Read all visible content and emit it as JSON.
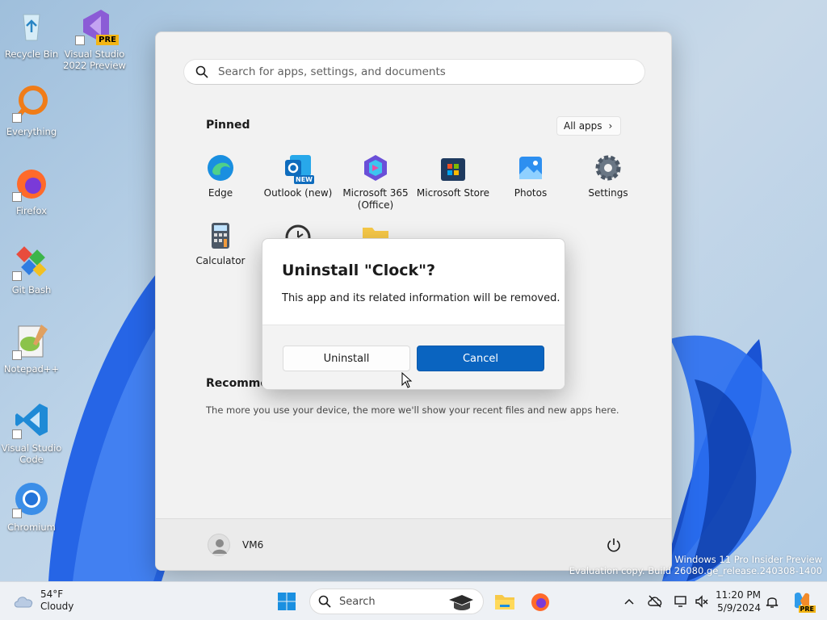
{
  "desktop": {
    "icons": [
      {
        "label": "Recycle Bin"
      },
      {
        "label": "Visual Studio 2022 Preview",
        "badge": "PRE"
      },
      {
        "label": "Everything"
      },
      {
        "label": "Firefox"
      },
      {
        "label": "Git Bash"
      },
      {
        "label": "Notepad++"
      },
      {
        "label": "Visual Studio Code"
      },
      {
        "label": "Chromium"
      }
    ],
    "watermark_line1": "Windows 11 Pro Insider Preview",
    "watermark_line2": "Evaluation copy. Build 26080.ge_release.240308-1400"
  },
  "start_menu": {
    "search_placeholder": "Search for apps, settings, and documents",
    "pinned_title": "Pinned",
    "all_apps_label": "All apps",
    "apps": [
      {
        "label": "Edge"
      },
      {
        "label": "Outlook (new)",
        "badge": "NEW"
      },
      {
        "label": "Microsoft 365 (Office)"
      },
      {
        "label": "Microsoft Store"
      },
      {
        "label": "Photos"
      },
      {
        "label": "Settings"
      },
      {
        "label": "Calculator"
      }
    ],
    "recommended_title": "Recommen",
    "recommended_text": "The more you use your device, the more we'll show your recent files and new apps here.",
    "user_name": "VM6"
  },
  "dialog": {
    "title": "Uninstall \"Clock\"?",
    "message": "This app and its related information will be removed.",
    "uninstall_label": "Uninstall",
    "cancel_label": "Cancel"
  },
  "taskbar": {
    "weather_temp": "54°F",
    "weather_desc": "Cloudy",
    "search_placeholder": "Search",
    "time": "11:20 PM",
    "date": "5/9/2024",
    "copilot_badge": "PRE"
  },
  "colors": {
    "accent": "#0a64c0",
    "bloom": "#1f5fe0"
  }
}
